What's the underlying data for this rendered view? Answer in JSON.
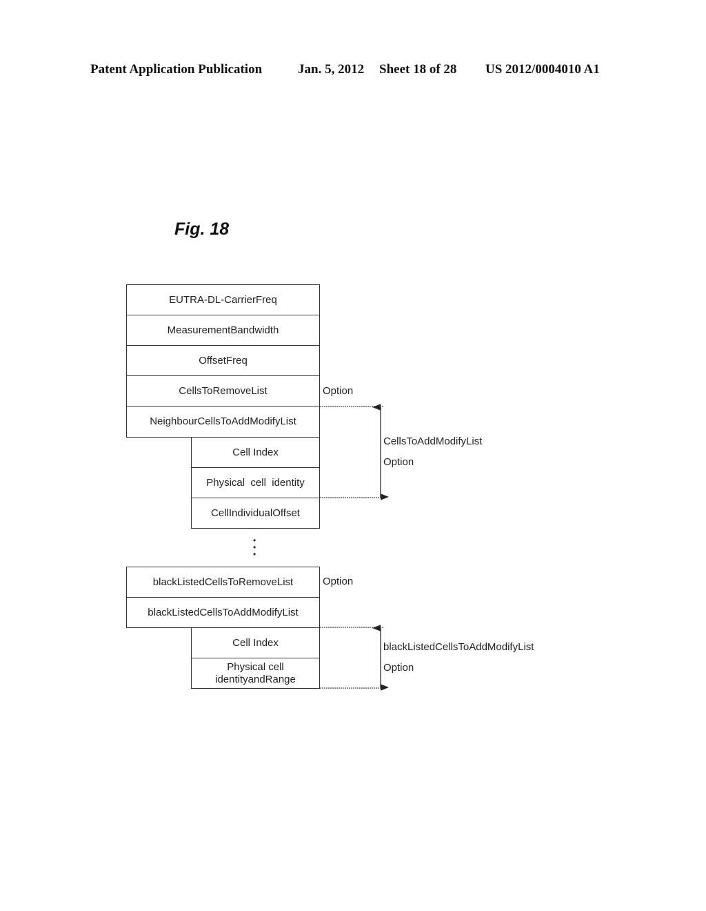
{
  "header": {
    "publication": "Patent Application Publication",
    "date": "Jan. 5, 2012",
    "sheet": "Sheet 18 of 28",
    "number": "US 2012/0004010 A1"
  },
  "figure": {
    "label": "Fig. 18"
  },
  "top_block": {
    "rows": [
      "EUTRA-DL-CarrierFreq",
      "MeasurementBandwidth",
      "OffsetFreq",
      "CellsToRemoveList",
      "NeighbourCellsToAddModifyList"
    ],
    "option_label": "Option"
  },
  "neighbour_sub_block": {
    "rows": [
      "Cell  Index",
      "Physical  cell  identity",
      "CellIndividualOffset"
    ],
    "bracket_label": "CellsToAddModifyList",
    "bracket_option": "Option"
  },
  "ellipsis": "⋮",
  "bottom_block": {
    "rows": [
      "blackListedCellsToRemoveList",
      "blackListedCellsToAddModifyList"
    ],
    "option_label": "Option"
  },
  "blacklist_sub_block": {
    "rows": [
      "Cell  Index",
      "Physical  cell\nidentityandRange"
    ],
    "bracket_label": "blackListedCellsToAddModifyList",
    "bracket_option": "Option"
  }
}
